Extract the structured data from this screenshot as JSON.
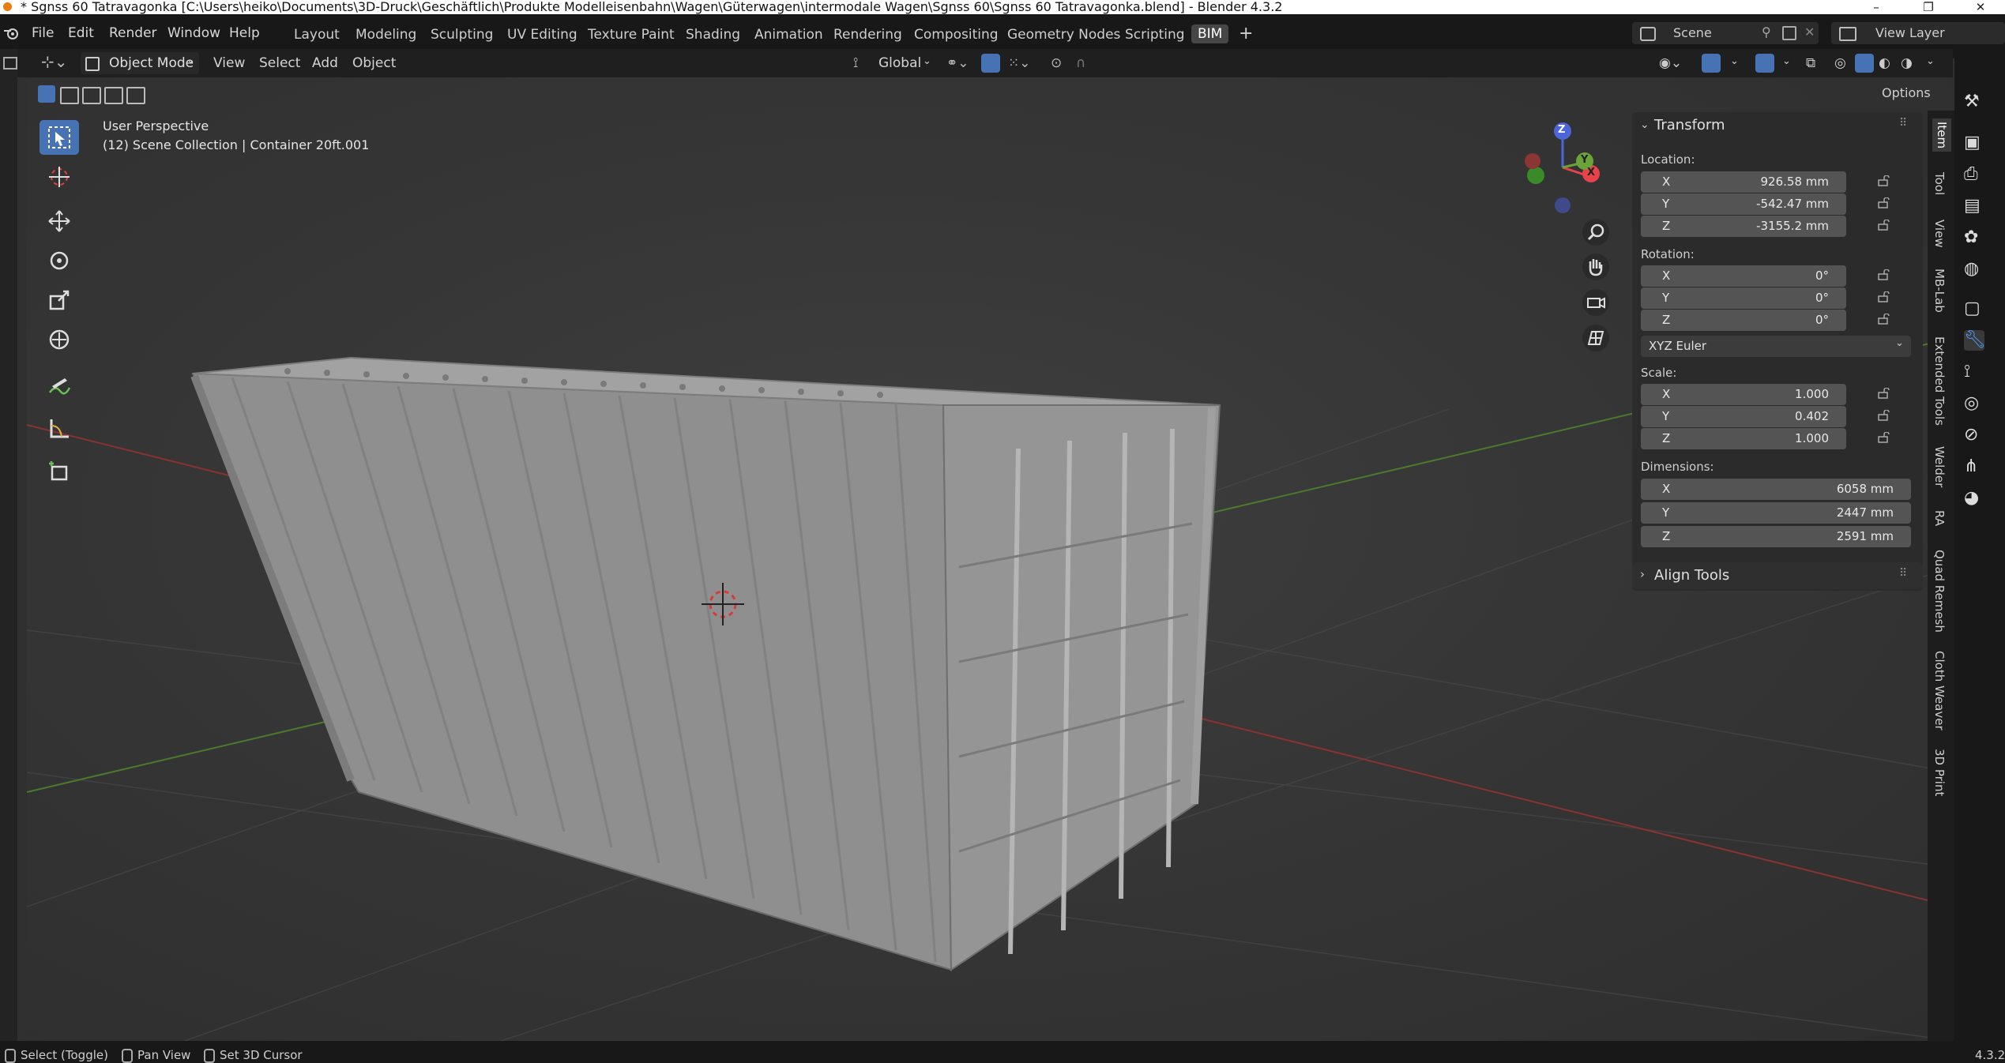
{
  "window": {
    "title": "* Sgnss 60 Tatravagonka [C:\\Users\\heiko\\Documents\\3D-Druck\\Geschäftlich\\Produkte Modelleisenbahn\\Wagen\\Güterwagen\\intermodale Wagen\\Sgnss 60\\Sgnss 60 Tatravagonka.blend] - Blender 4.3.2",
    "minimize": "–",
    "maximize": "❐",
    "close": "✕"
  },
  "menu": [
    "File",
    "Edit",
    "Render",
    "Window",
    "Help"
  ],
  "workspaces": [
    "Layout",
    "Modeling",
    "Sculpting",
    "UV Editing",
    "Texture Paint",
    "Shading",
    "Animation",
    "Rendering",
    "Compositing",
    "Geometry Nodes",
    "Scripting",
    "BIM"
  ],
  "active_workspace": "BIM",
  "add_workspace": "+",
  "scene": {
    "label": "Scene",
    "view_layer": "View Layer"
  },
  "header": {
    "mode": "Object Mode",
    "menus": [
      "View",
      "Select",
      "Add",
      "Object"
    ],
    "orientation": "Global",
    "options": "Options"
  },
  "viewport": {
    "perspective": "User Perspective",
    "collection": "(12) Scene Collection | Container 20ft.001"
  },
  "gizmo": {
    "z": "Z",
    "y": "Y",
    "x": "X"
  },
  "panel": {
    "transform_title": "Transform",
    "location_label": "Location:",
    "location": [
      {
        "axis": "X",
        "value": "926.58 mm"
      },
      {
        "axis": "Y",
        "value": "-542.47 mm"
      },
      {
        "axis": "Z",
        "value": "-3155.2 mm"
      }
    ],
    "rotation_label": "Rotation:",
    "rotation": [
      {
        "axis": "X",
        "value": "0°"
      },
      {
        "axis": "Y",
        "value": "0°"
      },
      {
        "axis": "Z",
        "value": "0°"
      }
    ],
    "rotation_mode": "XYZ Euler",
    "scale_label": "Scale:",
    "scale": [
      {
        "axis": "X",
        "value": "1.000"
      },
      {
        "axis": "Y",
        "value": "0.402"
      },
      {
        "axis": "Z",
        "value": "1.000"
      }
    ],
    "dimensions_label": "Dimensions:",
    "dimensions": [
      {
        "axis": "X",
        "value": "6058 mm"
      },
      {
        "axis": "Y",
        "value": "2447 mm"
      },
      {
        "axis": "Z",
        "value": "2591 mm"
      }
    ],
    "align_title": "Align Tools"
  },
  "side_tabs": [
    "Item",
    "Tool",
    "View",
    "MB-Lab",
    "Extended Tools",
    "Welder",
    "RA",
    "Quad Remesh",
    "Cloth Weaver",
    "3D Print"
  ],
  "status": {
    "select": "Select (Toggle)",
    "pan": "Pan View",
    "cursor": "Set 3D Cursor",
    "version": "4.3.2"
  },
  "colors": {
    "active_blue": "#4772b3",
    "axis_x": "#e8424b",
    "axis_y": "#6ba33a",
    "axis_z": "#4c66d9"
  }
}
